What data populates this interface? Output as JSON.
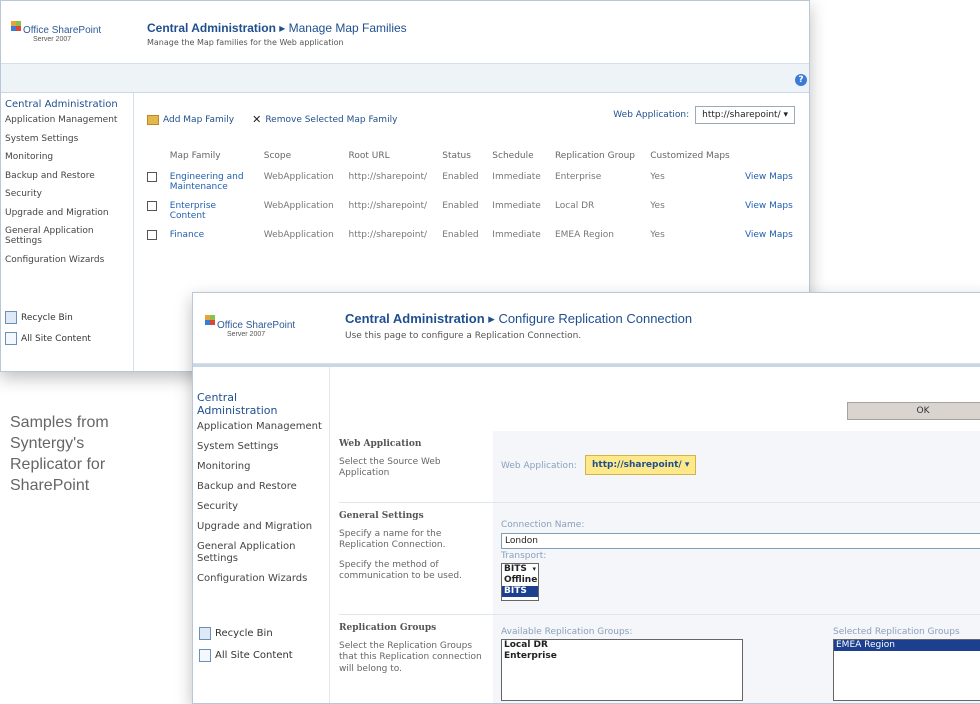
{
  "caption": [
    "Samples from",
    "Syntergy's",
    "Replicator for",
    "SharePoint"
  ],
  "colors": {
    "link": "#1f4f8f",
    "selected": "#1c3f8f",
    "webapp_highlight": "#fde88a"
  },
  "shot1": {
    "logo": {
      "line1": "Office SharePoint",
      "line2": "Server 2007"
    },
    "title": {
      "prefix": "Central Administration",
      "separator": "▸",
      "page": "Manage Map Families"
    },
    "subtitle": "Manage the Map families for the Web application",
    "help_icon": "help-icon",
    "nav": {
      "home": "Central Administration",
      "items": [
        "Application Management",
        "System Settings",
        "Monitoring",
        "Backup and Restore",
        "Security",
        "Upgrade and Migration",
        "General Application Settings",
        "Configuration Wizards"
      ],
      "recycle": "Recycle Bin",
      "all_content": "All Site Content"
    },
    "toolbar": {
      "add": "Add Map Family",
      "remove": "Remove Selected Map Family",
      "webapp_label": "Web Application:",
      "webapp_value": "http://sharepoint/ ▾"
    },
    "columns": [
      "Map Family",
      "Scope",
      "Root URL",
      "Status",
      "Schedule",
      "Replication Group",
      "Customized Maps",
      ""
    ],
    "rows": [
      {
        "name": "Engineering and Maintenance",
        "scope": "WebApplication",
        "url": "http://sharepoint/",
        "status": "Enabled",
        "schedule": "Immediate",
        "group": "Enterprise",
        "customized": "Yes",
        "view": "View Maps"
      },
      {
        "name": "Enterprise Content",
        "scope": "WebApplication",
        "url": "http://sharepoint/",
        "status": "Enabled",
        "schedule": "Immediate",
        "group": "Local DR",
        "customized": "Yes",
        "view": "View Maps"
      },
      {
        "name": "Finance",
        "scope": "WebApplication",
        "url": "http://sharepoint/",
        "status": "Enabled",
        "schedule": "Immediate",
        "group": "EMEA Region",
        "customized": "Yes",
        "view": "View Maps"
      }
    ]
  },
  "shot2": {
    "logo": {
      "line1": "Office SharePoint",
      "line2": "Server 2007"
    },
    "title": {
      "prefix": "Central Administration",
      "separator": "▸",
      "page": "Configure Replication Connection"
    },
    "subtitle": "Use this page to configure a Replication Connection.",
    "ok_label": "OK",
    "nav": {
      "home": "Central Administration",
      "items": [
        "Application Management",
        "System Settings",
        "Monitoring",
        "Backup and Restore",
        "Security",
        "Upgrade and Migration",
        "General Application Settings",
        "Configuration Wizards"
      ],
      "recycle": "Recycle Bin",
      "all_content": "All Site Content"
    },
    "sections": {
      "webapp": {
        "heading": "Web Application",
        "desc": "Select the Source Web Application",
        "field_label": "Web Application:",
        "value": "http://sharepoint/ ▾"
      },
      "general": {
        "heading": "General Settings",
        "desc1": "Specify a name for the Replication Connection.",
        "desc2": "Specify the method of communication to be used.",
        "name_label": "Connection Name:",
        "name_value": "London",
        "transport_label": "Transport:",
        "transport_options": [
          "BITS",
          "Offline",
          "BITS"
        ]
      },
      "groups": {
        "heading": "Replication Groups",
        "desc": "Select the Replication Groups that this Replication connection will belong to.",
        "available_label": "Available Replication Groups:",
        "available": [
          "Local DR",
          "Enterprise"
        ],
        "selected_label": "Selected Replication Groups",
        "selected": [
          "EMEA Region"
        ]
      }
    }
  }
}
